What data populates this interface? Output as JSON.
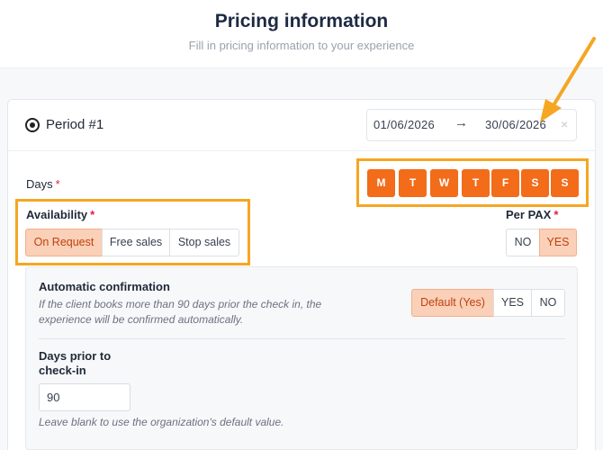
{
  "header": {
    "title": "Pricing information",
    "subtitle": "Fill in pricing information to your experience"
  },
  "period": {
    "title": "Period #1",
    "date_start": "01/06/2026",
    "date_arrow": "→",
    "date_end": "30/06/2026",
    "clear_glyph": "×"
  },
  "days": {
    "label": "Days",
    "required_mark": "*",
    "items": [
      "M",
      "T",
      "W",
      "T",
      "F",
      "S",
      "S"
    ]
  },
  "availability": {
    "label": "Availability",
    "required_mark": "*",
    "options": [
      "On Request",
      "Free sales",
      "Stop sales"
    ],
    "selected": "On Request"
  },
  "per_pax": {
    "label": "Per PAX",
    "required_mark": "*",
    "options": [
      "NO",
      "YES"
    ],
    "selected": "YES"
  },
  "auto_confirm": {
    "label": "Automatic confirmation",
    "description_line1": "If the client books more than 90 days prior the check in, the",
    "description_line2": "experience will be confirmed automatically.",
    "options": [
      "Default (Yes)",
      "YES",
      "NO"
    ],
    "selected": "Default (Yes)"
  },
  "days_prior": {
    "label_line1": "Days prior to",
    "label_line2": "check-in",
    "value": "90",
    "hint": "Leave blank to use the organization's default value."
  },
  "colors": {
    "accent": "#f26c1a",
    "annotation": "#f5a623",
    "selected_bg": "#fad0b8"
  }
}
